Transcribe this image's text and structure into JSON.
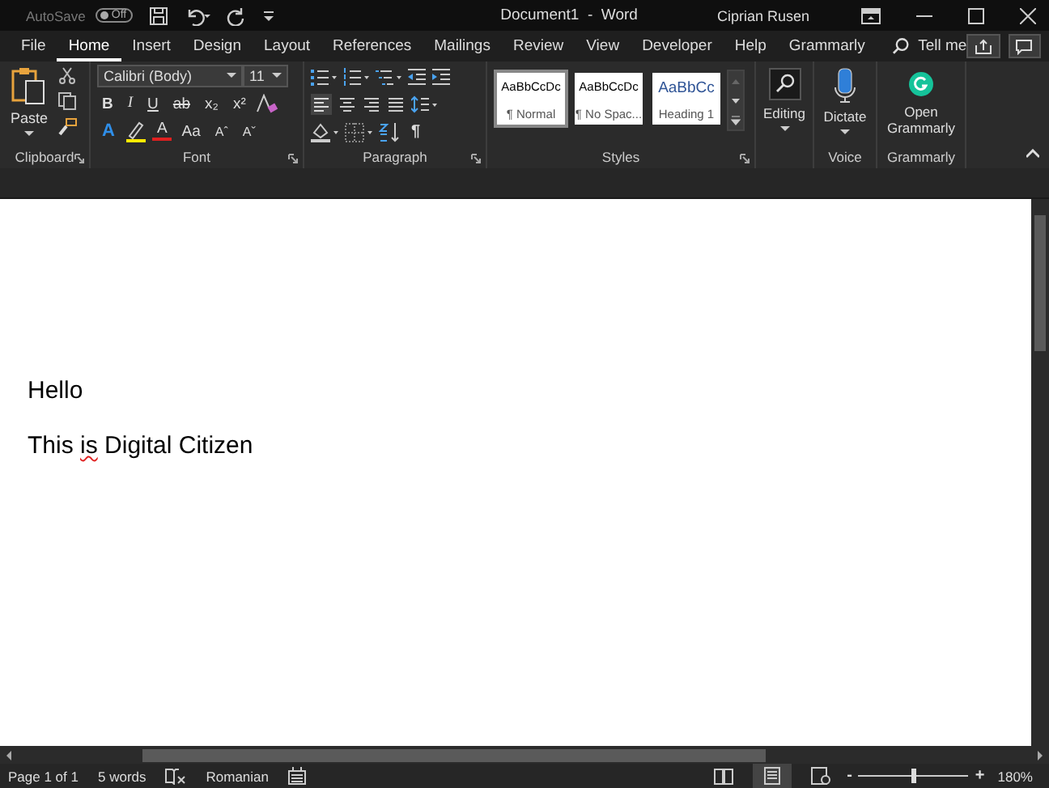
{
  "title_bar": {
    "autosave_label": "AutoSave",
    "autosave_toggle": {
      "label": "Off",
      "on": false
    },
    "document_title": "Document1  -  Word",
    "user": "Ciprian Rusen"
  },
  "tabs": [
    {
      "label": "File",
      "selected": false
    },
    {
      "label": "Home",
      "selected": true
    },
    {
      "label": "Insert",
      "selected": false
    },
    {
      "label": "Design",
      "selected": false
    },
    {
      "label": "Layout",
      "selected": false
    },
    {
      "label": "References",
      "selected": false
    },
    {
      "label": "Mailings",
      "selected": false
    },
    {
      "label": "Review",
      "selected": false
    },
    {
      "label": "View",
      "selected": false
    },
    {
      "label": "Developer",
      "selected": false
    },
    {
      "label": "Help",
      "selected": false
    },
    {
      "label": "Grammarly",
      "selected": false
    }
  ],
  "tell_me": "Tell me",
  "ribbon": {
    "clipboard": {
      "paste": "Paste",
      "label": "Clipboard"
    },
    "font": {
      "font_name": "Calibri (Body)",
      "font_size": "11",
      "format_buttons": [
        "B",
        "I",
        "U",
        "ab",
        "x₂",
        "x²"
      ],
      "effects": "A",
      "font_color": "A",
      "change_case": "Aa",
      "grow": "Aˆ",
      "shrink": "Aˇ",
      "label": "Font"
    },
    "paragraph": {
      "show_marks": "¶",
      "label": "Paragraph"
    },
    "styles": {
      "items": [
        {
          "preview": "AaBbCcDc",
          "name": "¶ Normal",
          "color": "#000000",
          "selected": true
        },
        {
          "preview": "AaBbCcDc",
          "name": "¶ No Spac...",
          "color": "#000000",
          "selected": false
        },
        {
          "preview": "AaBbCc",
          "name": "Heading 1",
          "color": "#2f5496",
          "selected": false
        }
      ],
      "label": "Styles"
    },
    "editing": {
      "button": "Editing"
    },
    "voice": {
      "button": "Dictate",
      "label": "Voice"
    },
    "grammarly": {
      "button": "Open Grammarly",
      "label": "Grammarly"
    }
  },
  "document": {
    "paragraphs": [
      {
        "segments": [
          {
            "text": "Hello",
            "misspelled": false
          }
        ]
      },
      {
        "segments": [
          {
            "text": "This ",
            "misspelled": false
          },
          {
            "text": "is",
            "misspelled": true
          },
          {
            "text": " Digital Citizen",
            "misspelled": false
          }
        ]
      }
    ]
  },
  "status_bar": {
    "page": "Page 1 of 1",
    "words": "5 words",
    "language": "Romanian",
    "views": [
      {
        "kind": "read",
        "selected": false
      },
      {
        "kind": "print",
        "selected": true
      },
      {
        "kind": "web",
        "selected": false
      }
    ],
    "zoom_minus": "-",
    "zoom": {
      "level": 0.5
    },
    "zoom_plus": "+",
    "zoom_percent": "180%"
  }
}
